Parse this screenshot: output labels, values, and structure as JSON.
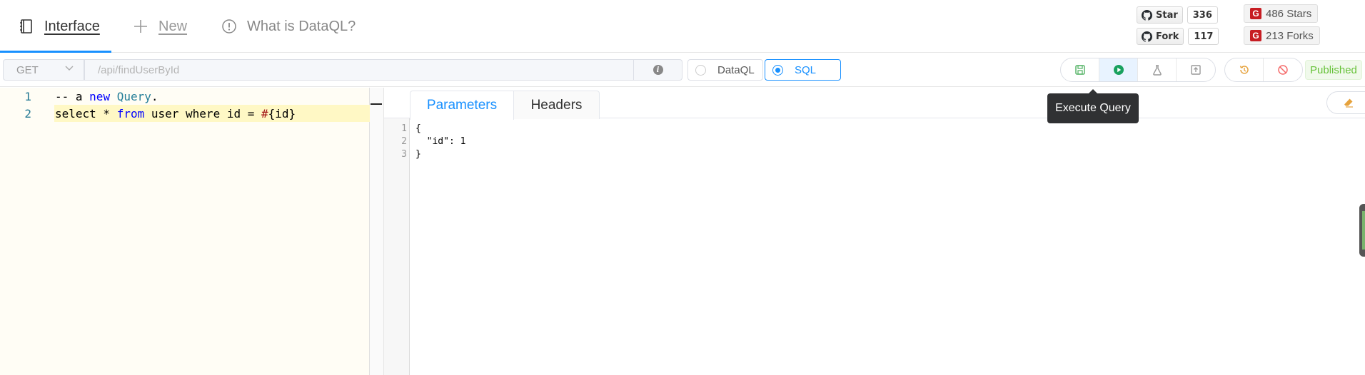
{
  "nav": {
    "tabs": [
      {
        "label": "Interface",
        "icon": "notebook-icon"
      },
      {
        "label": "New",
        "icon": "plus-icon"
      },
      {
        "label": "What is DataQL?",
        "icon": "info-circle-icon"
      }
    ]
  },
  "badges": {
    "github_star": {
      "label": "Star",
      "count": "336"
    },
    "github_fork": {
      "label": "Fork",
      "count": "117"
    },
    "gitee_stars": "486 Stars",
    "gitee_forks": "213 Forks",
    "gitee_color": "#c71d23"
  },
  "toolbar": {
    "method": "GET",
    "url_placeholder": "/api/findUserById",
    "radio_dataql": "DataQL",
    "radio_sql": "SQL",
    "selected_mode": "SQL",
    "published_label": "Published",
    "tooltip": "Execute Query",
    "accent_color": "#1890ff",
    "published_color": "#67c23a"
  },
  "editor": {
    "lines": [
      {
        "num": "1",
        "text": "-- a new Query."
      },
      {
        "num": "2",
        "text": "select * from user where id = #{id}"
      }
    ]
  },
  "right": {
    "tabs": [
      {
        "label": "Parameters",
        "active": true
      },
      {
        "label": "Headers",
        "active": false
      }
    ],
    "json_lines": [
      {
        "num": "1",
        "text": "{"
      },
      {
        "num": "2",
        "text": "  \"id\": 1"
      },
      {
        "num": "3",
        "text": "}"
      }
    ]
  }
}
